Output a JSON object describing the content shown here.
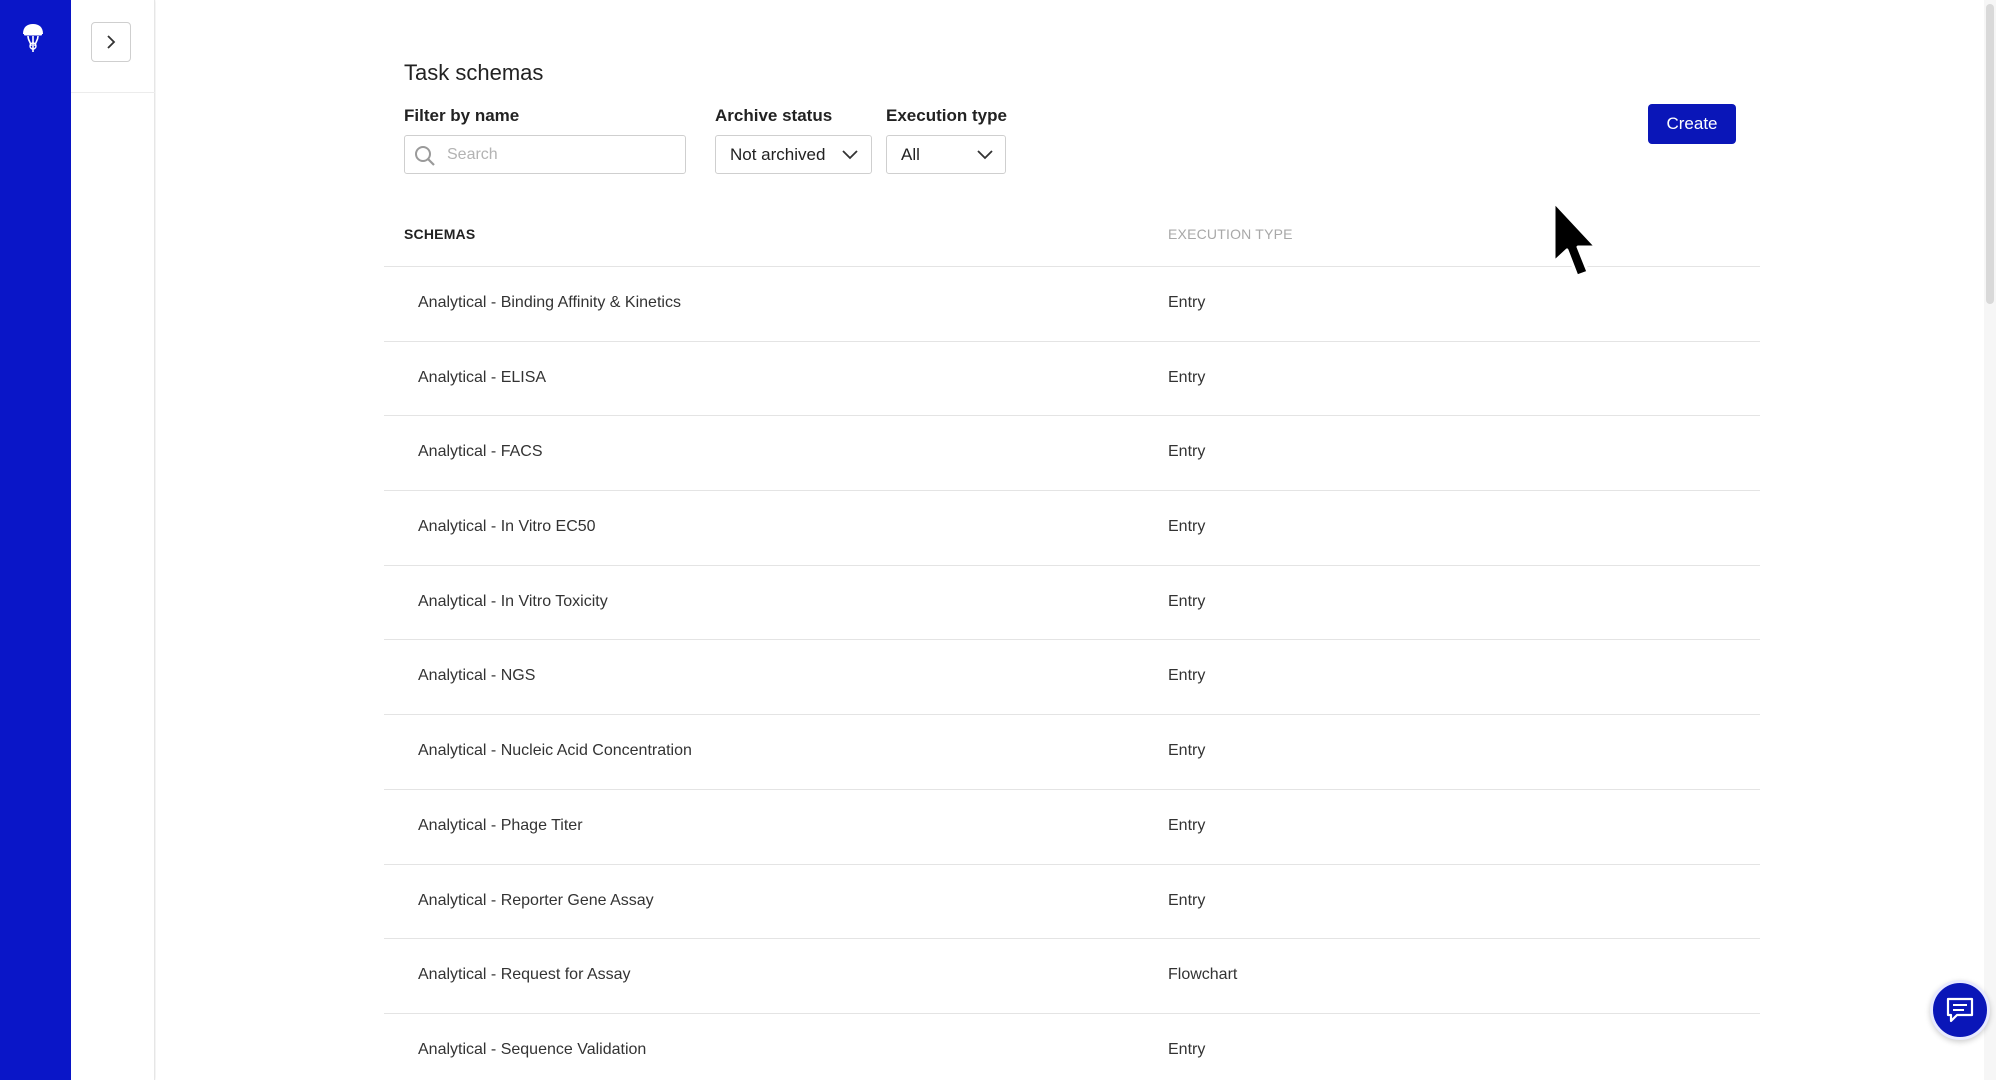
{
  "page": {
    "title": "Task schemas"
  },
  "filters": {
    "name_label": "Filter by name",
    "search_placeholder": "Search",
    "search_value": "",
    "archive_label": "Archive status",
    "archive_value": "Not archived",
    "execution_label": "Execution type",
    "execution_value": "All"
  },
  "actions": {
    "create_label": "Create"
  },
  "table": {
    "columns": {
      "schemas": "SCHEMAS",
      "execution_type": "EXECUTION TYPE"
    },
    "rows": [
      {
        "name": "Analytical - Binding Affinity & Kinetics",
        "type": "Entry"
      },
      {
        "name": "Analytical - ELISA",
        "type": "Entry"
      },
      {
        "name": "Analytical - FACS",
        "type": "Entry"
      },
      {
        "name": "Analytical - In Vitro EC50",
        "type": "Entry"
      },
      {
        "name": "Analytical - In Vitro Toxicity",
        "type": "Entry"
      },
      {
        "name": "Analytical - NGS",
        "type": "Entry"
      },
      {
        "name": "Analytical - Nucleic Acid Concentration",
        "type": "Entry"
      },
      {
        "name": "Analytical - Phage Titer",
        "type": "Entry"
      },
      {
        "name": "Analytical - Reporter Gene Assay",
        "type": "Entry"
      },
      {
        "name": "Analytical - Request for Assay",
        "type": "Flowchart"
      },
      {
        "name": "Analytical - Sequence Validation",
        "type": "Entry"
      }
    ]
  },
  "icons": {
    "logo": "jellyfish-logo-icon",
    "expand": "chevron-right-icon",
    "search": "search-icon",
    "dropdown": "chevron-down-icon",
    "chat": "chat-icon",
    "cursor": "mouse-pointer-icon"
  },
  "colors": {
    "brand_rail": "#0a16c8",
    "primary_button": "#0a16b8"
  }
}
